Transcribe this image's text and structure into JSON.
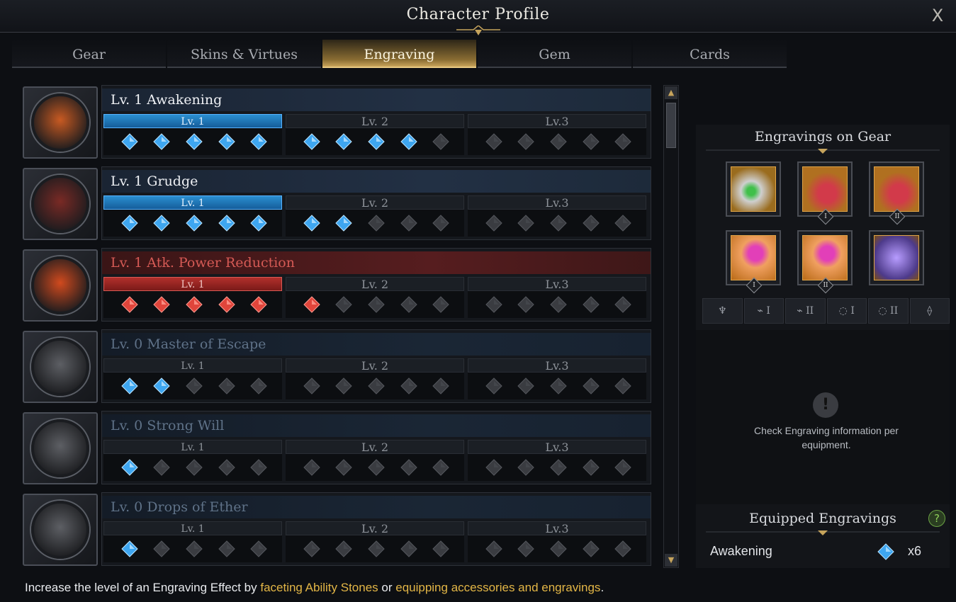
{
  "window": {
    "title": "Character Profile",
    "close_label": "X"
  },
  "tabs": [
    {
      "label": "Gear",
      "active": false
    },
    {
      "label": "Skins & Virtues",
      "active": false
    },
    {
      "label": "Engraving",
      "active": true
    },
    {
      "label": "Gem",
      "active": false
    },
    {
      "label": "Cards",
      "active": false
    }
  ],
  "level_labels": [
    "Lv. 1",
    "Lv. 2",
    "Lv.3"
  ],
  "engravings": [
    {
      "name": "Lv. 1 Awakening",
      "type": "normal",
      "state": "active",
      "filled": 9,
      "icon_color": "#c85a22"
    },
    {
      "name": "Lv. 1 Grudge",
      "type": "normal",
      "state": "active",
      "filled": 7,
      "icon_color": "#7a2a25"
    },
    {
      "name": "Lv. 1 Atk. Power Reduction",
      "type": "debuff",
      "state": "active",
      "filled": 6,
      "icon_color": "#d14a1e"
    },
    {
      "name": "Lv. 0 Master of Escape",
      "type": "normal",
      "state": "dim",
      "filled": 2,
      "icon_color": "#5d5f64"
    },
    {
      "name": "Lv. 0 Strong Will",
      "type": "normal",
      "state": "dim",
      "filled": 1,
      "icon_color": "#5d5f64"
    },
    {
      "name": "Lv. 0 Drops of Ether",
      "type": "normal",
      "state": "dim",
      "filled": 1,
      "icon_color": "#5d5f64"
    }
  ],
  "right_panel": {
    "gear_title": "Engravings on Gear",
    "gear_slots": [
      {
        "item": "necklace-icon",
        "badge": ""
      },
      {
        "item": "earring-icon",
        "badge": "I"
      },
      {
        "item": "earring-icon",
        "badge": "II"
      },
      {
        "item": "ring-icon",
        "badge": "I"
      },
      {
        "item": "ring-icon",
        "badge": "II"
      },
      {
        "item": "ability-stone-icon",
        "badge": ""
      }
    ],
    "filters": [
      "",
      "I",
      "II",
      "I",
      "II",
      ""
    ],
    "info_text": "Check Engraving information per equipment.",
    "equipped_title": "Equipped Engravings",
    "help_label": "?",
    "equipped": [
      {
        "name": "Awakening",
        "count": "x6"
      }
    ]
  },
  "footer": {
    "prefix": "Increase the level of an Engraving Effect by ",
    "link1": "faceting Ability Stones",
    "mid": " or ",
    "link2": "equipping accessories and engravings",
    "suffix": "."
  },
  "colors": {
    "accent_gold": "#e3b646",
    "node_blue": "#3ea6f0",
    "node_red": "#e0453b",
    "node_empty": "#3a3c41"
  }
}
